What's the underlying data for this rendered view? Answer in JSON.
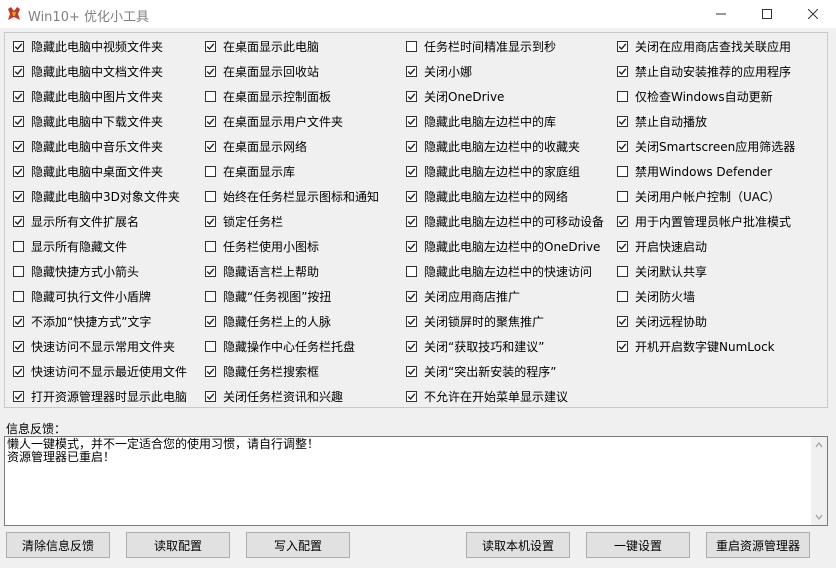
{
  "window": {
    "title": "Win10+ 优化小工具",
    "icon": "app-icon",
    "controls": [
      "minimize-icon",
      "maximize-icon",
      "close-icon"
    ]
  },
  "options": {
    "col1": [
      {
        "label": "隐藏此电脑中视频文件夹",
        "checked": true
      },
      {
        "label": "隐藏此电脑中文档文件夹",
        "checked": true
      },
      {
        "label": "隐藏此电脑中图片文件夹",
        "checked": true
      },
      {
        "label": "隐藏此电脑中下载文件夹",
        "checked": true
      },
      {
        "label": "隐藏此电脑中音乐文件夹",
        "checked": true
      },
      {
        "label": "隐藏此电脑中桌面文件夹",
        "checked": true
      },
      {
        "label": "隐藏此电脑中3D对象文件夹",
        "checked": true
      },
      {
        "label": "显示所有文件扩展名",
        "checked": true
      },
      {
        "label": "显示所有隐藏文件",
        "checked": false
      },
      {
        "label": "隐藏快捷方式小箭头",
        "checked": false
      },
      {
        "label": "隐藏可执行文件小盾牌",
        "checked": false
      },
      {
        "label": "不添加“快捷方式”文字",
        "checked": true
      },
      {
        "label": "快速访问不显示常用文件夹",
        "checked": true
      },
      {
        "label": "快速访问不显示最近使用文件",
        "checked": true
      },
      {
        "label": "打开资源管理器时显示此电脑",
        "checked": true
      }
    ],
    "col2": [
      {
        "label": "在桌面显示此电脑",
        "checked": true
      },
      {
        "label": "在桌面显示回收站",
        "checked": true
      },
      {
        "label": "在桌面显示控制面板",
        "checked": false
      },
      {
        "label": "在桌面显示用户文件夹",
        "checked": true
      },
      {
        "label": "在桌面显示网络",
        "checked": true
      },
      {
        "label": "在桌面显示库",
        "checked": false
      },
      {
        "label": "始终在任务栏显示图标和通知",
        "checked": false
      },
      {
        "label": "锁定任务栏",
        "checked": true
      },
      {
        "label": "任务栏使用小图标",
        "checked": false
      },
      {
        "label": "隐藏语言栏上帮助",
        "checked": true
      },
      {
        "label": "隐藏“任务视图”按扭",
        "checked": false
      },
      {
        "label": "隐藏任务栏上的人脉",
        "checked": true
      },
      {
        "label": "隐藏操作中心任务栏托盘",
        "checked": false
      },
      {
        "label": "隐藏任务栏搜索框",
        "checked": true
      },
      {
        "label": "关闭任务栏资讯和兴趣",
        "checked": true
      }
    ],
    "col3": [
      {
        "label": "任务栏时间精准显示到秒",
        "checked": false
      },
      {
        "label": "关闭小娜",
        "checked": true
      },
      {
        "label": "关闭OneDrive",
        "checked": true
      },
      {
        "label": "隐藏此电脑左边栏中的库",
        "checked": true
      },
      {
        "label": "隐藏此电脑左边栏中的收藏夹",
        "checked": true
      },
      {
        "label": "隐藏此电脑左边栏中的家庭组",
        "checked": true
      },
      {
        "label": "隐藏此电脑左边栏中的网络",
        "checked": true
      },
      {
        "label": "隐藏此电脑左边栏中的可移动设备",
        "checked": true
      },
      {
        "label": "隐藏此电脑左边栏中的OneDrive",
        "checked": true
      },
      {
        "label": "隐藏此电脑左边栏中的快速访问",
        "checked": false
      },
      {
        "label": "关闭应用商店推广",
        "checked": true
      },
      {
        "label": "关闭锁屏时的聚焦推广",
        "checked": true
      },
      {
        "label": "关闭“获取技巧和建议”",
        "checked": true
      },
      {
        "label": "关闭“突出新安装的程序”",
        "checked": true
      },
      {
        "label": "不允许在开始菜单显示建议",
        "checked": true
      }
    ],
    "col4": [
      {
        "label": "关闭在应用商店查找关联应用",
        "checked": true
      },
      {
        "label": "禁止自动安装推荐的应用程序",
        "checked": true
      },
      {
        "label": "仅检查Windows自动更新",
        "checked": false
      },
      {
        "label": "禁止自动播放",
        "checked": true
      },
      {
        "label": "关闭Smartscreen应用筛选器",
        "checked": true
      },
      {
        "label": "禁用Windows Defender",
        "checked": false
      },
      {
        "label": "关闭用户帐户控制（UAC）",
        "checked": false
      },
      {
        "label": "用于内置管理员帐户批准模式",
        "checked": true
      },
      {
        "label": "开启快速启动",
        "checked": true
      },
      {
        "label": "关闭默认共享",
        "checked": false
      },
      {
        "label": "关闭防火墙",
        "checked": false
      },
      {
        "label": "关闭远程协助",
        "checked": true
      },
      {
        "label": "开机开启数字键NumLock",
        "checked": true
      }
    ]
  },
  "feedback": {
    "label": "信息反馈：",
    "text": "懒人一键模式，并不一定适合您的使用习惯，请自行调整！\n资源管理器已重启！"
  },
  "buttons": {
    "clear": "清除信息反馈",
    "read_config": "读取配置",
    "write_config": "写入配置",
    "read_local": "读取本机设置",
    "one_click": "一键设置",
    "restart_explorer": "重启资源管理器"
  }
}
